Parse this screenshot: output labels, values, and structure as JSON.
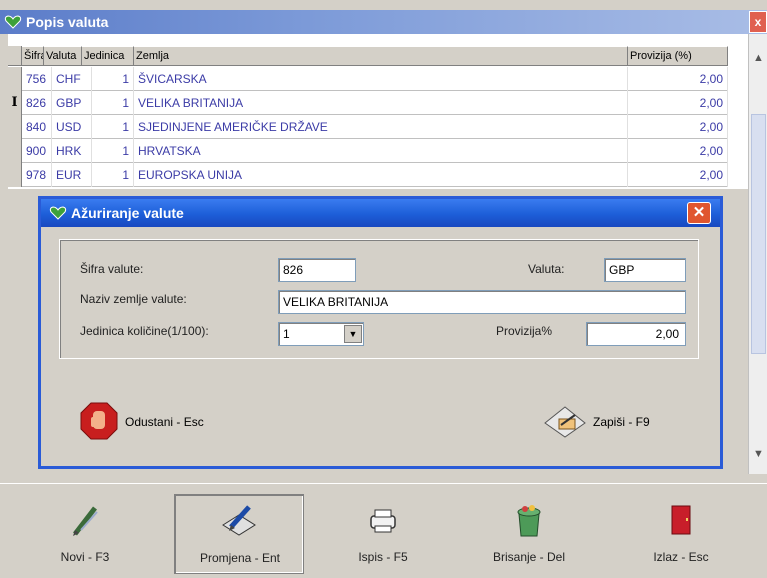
{
  "main": {
    "title": "Popis valuta",
    "close_label": "x"
  },
  "grid": {
    "columns": [
      "Šifra",
      "Valuta",
      "Jedinica",
      "Zemlja",
      "Provizija (%)"
    ],
    "rows": [
      {
        "indicator": "",
        "code": "756",
        "valuta": "CHF",
        "jedinica": "1",
        "zemlja": "ŠVICARSKA",
        "provizija": "2,00"
      },
      {
        "indicator": "I",
        "code": "826",
        "valuta": "GBP",
        "jedinica": "1",
        "zemlja": "VELIKA BRITANIJA",
        "provizija": "2,00"
      },
      {
        "indicator": "",
        "code": "840",
        "valuta": "USD",
        "jedinica": "1",
        "zemlja": "SJEDINJENE AMERIČKE DRŽAVE",
        "provizija": "2,00"
      },
      {
        "indicator": "",
        "code": "900",
        "valuta": "HRK",
        "jedinica": "1",
        "zemlja": "HRVATSKA",
        "provizija": "2,00"
      },
      {
        "indicator": "",
        "code": "978",
        "valuta": "EUR",
        "jedinica": "1",
        "zemlja": "EUROPSKA UNIJA",
        "provizija": "2,00"
      }
    ]
  },
  "dialog": {
    "title": "Ažuriranje valute",
    "close_label": "✕",
    "sifra_label": "Šifra valute:",
    "sifra_value": "826",
    "valuta_label": "Valuta:",
    "valuta_value": "GBP",
    "naziv_label": "Naziv zemlje valute:",
    "naziv_value": "VELIKA BRITANIJA",
    "jedinica_label": "Jedinica količine(1/100):",
    "jedinica_value": "1",
    "provizija_label": "Provizija%",
    "provizija_value": "2,00",
    "cancel_label": "Odustani - Esc",
    "save_label": "Zapiši - F9"
  },
  "toolbar": {
    "new_label": "Novi - F3",
    "edit_label": "Promjena - Ent",
    "print_label": "Ispis - F5",
    "delete_label": "Brisanje - Del",
    "exit_label": "Izlaz - Esc"
  },
  "colors": {
    "grid_text": "#3b3ba6",
    "dialog_title": "#1d5ed8",
    "close_red": "#e0562f"
  }
}
